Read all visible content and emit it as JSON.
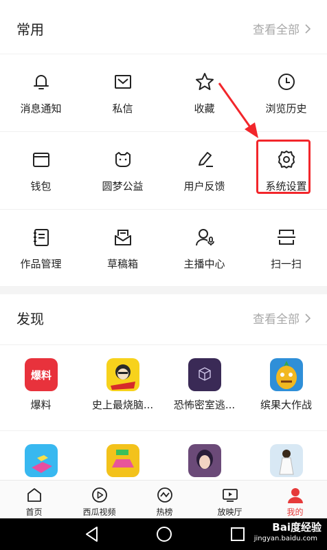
{
  "common": {
    "title": "常用",
    "view_all": "查看全部",
    "items": [
      {
        "label": "消息通知",
        "icon": "bell-icon"
      },
      {
        "label": "私信",
        "icon": "envelope-icon"
      },
      {
        "label": "收藏",
        "icon": "star-icon"
      },
      {
        "label": "浏览历史",
        "icon": "clock-icon"
      },
      {
        "label": "钱包",
        "icon": "wallet-icon"
      },
      {
        "label": "圆梦公益",
        "icon": "charity-cat-icon"
      },
      {
        "label": "用户反馈",
        "icon": "pen-icon"
      },
      {
        "label": "系统设置",
        "icon": "gear-icon"
      },
      {
        "label": "作品管理",
        "icon": "notebook-icon"
      },
      {
        "label": "草稿箱",
        "icon": "drafts-icon"
      },
      {
        "label": "主播中心",
        "icon": "streamer-icon"
      },
      {
        "label": "扫一扫",
        "icon": "scan-icon"
      }
    ]
  },
  "discover": {
    "title": "发现",
    "view_all": "查看全部",
    "apps": [
      {
        "label": "爆料",
        "logo_text": "爆料",
        "color": "#e8323c"
      },
      {
        "label": "史上最烧脑...",
        "color": "#f7d21c"
      },
      {
        "label": "恐怖密室逃...",
        "color": "#3a2a56"
      },
      {
        "label": "缤果大作战",
        "color": "#2f8fd8"
      },
      {
        "label": "",
        "color": "#38b8f0"
      },
      {
        "label": "",
        "color": "#f3c21b"
      },
      {
        "label": "",
        "color": "#6b4a78"
      },
      {
        "label": "",
        "color": "#d8e8f4"
      }
    ]
  },
  "tabbar": {
    "tabs": [
      {
        "label": "首页",
        "icon": "home-icon"
      },
      {
        "label": "西瓜视频",
        "icon": "play-circle-icon"
      },
      {
        "label": "热榜",
        "icon": "trending-icon"
      },
      {
        "label": "放映厅",
        "icon": "tv-play-icon"
      },
      {
        "label": "我的",
        "icon": "user-icon",
        "active": true
      }
    ]
  },
  "watermark": {
    "text": "Bai度经验",
    "sub": "jingyan.baidu.com"
  },
  "colors": {
    "accent": "#e63a3a",
    "highlight": "#f2262b"
  }
}
